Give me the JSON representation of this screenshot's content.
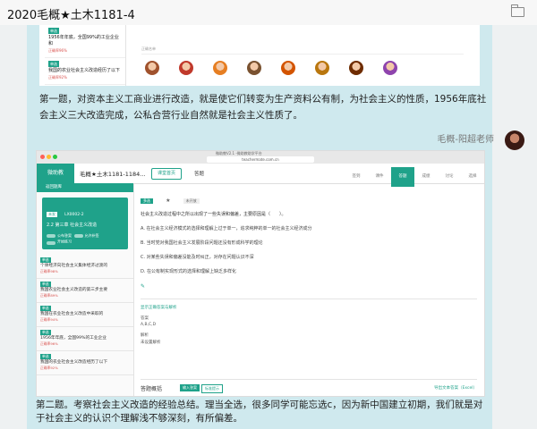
{
  "window": {
    "title": "2020毛概★土木1181-4"
  },
  "msg1": {
    "screenshot": {
      "items": [
        {
          "tag": "单选",
          "text": "1956年年底，全国99%的工业企业和",
          "rate": "正确率96%"
        },
        {
          "tag": "单选",
          "text": "我国的农业社会主义改造经历了以下",
          "rate": "正确率92%"
        }
      ],
      "header": "正确名单",
      "avatar_colors": [
        "#a0522d",
        "#c0392b",
        "#e67e22",
        "#7a5230",
        "#d35400",
        "#b9770e",
        "#6e2c00",
        "#8e44ad"
      ]
    },
    "text": "第一题，对资本主义工商业进行改造，就是使它们转变为生产资料公有制，为社会主义的性质，1956年底社会主义三大改造完成，公私合营行业自然就是社会主义性质了。"
  },
  "sender": {
    "name": "毛概-阳超老师"
  },
  "msg2": {
    "browser": {
      "tab": "微助教V2.1 -微助教助学平台",
      "url": "teachermate.com.cn",
      "dot_colors": [
        "#ff5f57",
        "#febc2e",
        "#28c840"
      ]
    },
    "app": {
      "logo": "微助教",
      "course": "毛概★土木1181-1184...",
      "home": "课堂首页",
      "answer": "答题",
      "nav": [
        "签到",
        "课件",
        "答题",
        "成绩",
        "讨论",
        "选择"
      ],
      "active_nav": "答题"
    },
    "sidebar": {
      "back": "返回题库",
      "card": {
        "tag": "未发",
        "code": "LX0002-2",
        "title": "2.2 第三章 社会主义改造",
        "toggle1": "公布答案",
        "toggle2": "允许补签",
        "toggle3": "开始练习"
      },
      "items": [
        {
          "tag": "单选",
          "text": "个体经济向社会主义集体经济过渡的",
          "rate": "正确率98%"
        },
        {
          "tag": "单选",
          "text": "我国农业社会主义改造的第三步主要",
          "rate": "正确率89%"
        },
        {
          "tag": "单选",
          "text": "我国在农业社会主义改造中采取的",
          "rate": "正确率94%"
        },
        {
          "tag": "单选",
          "text": "1956年年底，全国99%的工业企业",
          "rate": "正确率96%"
        },
        {
          "tag": "单选",
          "text": "我国的农业社会主义改造经历了以下",
          "rate": "正确率92%"
        }
      ]
    },
    "question": {
      "type": "多选",
      "status": "未开放",
      "stem": "社会主义改造过程中之所以出现了一些失误和偏差，主要原因是（　　）。",
      "options": [
        "A. 在社会主义经济模式的选择和理解上过于单一，追求纯粹的单一的社会主义经济成分",
        "B. 当时党对我国社会主义发展阶段问题还没有形成科学的理论",
        "C. 对某些失误和偏差没能及时纠正，对存在问题认识不深",
        "D. 在公有制实现形式的选择和理解上缺乏多样化"
      ],
      "show_answer": "显示正确答案与解析",
      "answer_label": "答案",
      "answer_value": "A,B,C,D",
      "analysis_label": "解析",
      "analysis_value": "未设置解析"
    },
    "stats": {
      "label": "答题概括",
      "btn1": "输入答案",
      "btn2": "标准提示",
      "export": "导出文本答案（Excel）"
    },
    "text": "第二题。考察社会主义改造的经验总结。理当全选，很多同学可能忘选c，因为新中国建立初期，我们就是对于社会主义的认识个理解浅不够深刻，有所偏差。"
  },
  "colors": {
    "accent": "#1fa28a",
    "bubble": "#cfe9ee",
    "rate": "#d9534f"
  }
}
